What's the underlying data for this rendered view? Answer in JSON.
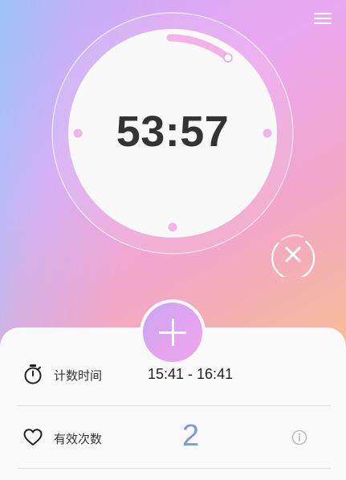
{
  "timer": {
    "display": "53:57",
    "progress_fraction": 0.18
  },
  "record": {
    "time_label": "计数时间",
    "time_range": "15:41 - 16:41",
    "count_label": "有效次数",
    "count_value": "2"
  },
  "icons": {
    "menu": "hamburger-menu-icon",
    "cancel": "close-circle-icon",
    "add": "plus-icon",
    "stopwatch": "stopwatch-icon",
    "heart": "heart-icon",
    "info": "info-icon"
  },
  "colors": {
    "accent_pink": "#f0b4e4",
    "count_blue": "#7a9ce0",
    "timer_text": "#333333"
  }
}
